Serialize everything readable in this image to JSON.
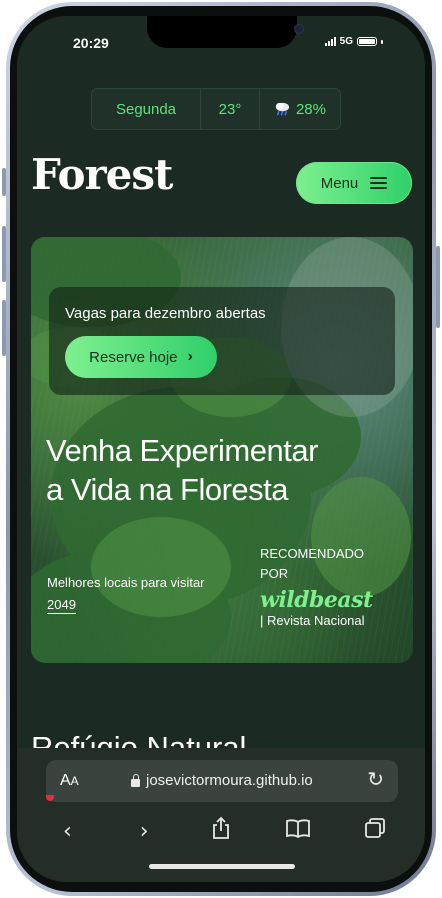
{
  "status_bar": {
    "time": "20:29",
    "network": "5G"
  },
  "info_bar": {
    "day": "Segunda",
    "temperature": "23°",
    "rain_chance": "28%",
    "rain_icon": "cloud-rain-icon"
  },
  "brand": "Forest",
  "menu": {
    "label": "Menu",
    "icon": "hamburger-icon"
  },
  "hero": {
    "notice": "Vagas para dezembro abertas",
    "cta_label": "Reserve hoje",
    "title_line1": "Venha Experimentar",
    "title_line2": "a Vida na Floresta",
    "places_label": "Melhores locais para visitar",
    "places_link": "2049",
    "recommended_line1": "RECOMENDADO",
    "recommended_line2": "POR",
    "publisher": "wildbeast",
    "publisher_sub": "| Revista Nacional"
  },
  "section": {
    "title": "Refúgio Natural"
  },
  "browser": {
    "text_size_label_big": "A",
    "text_size_label_small": "A",
    "url": "josevictormoura.github.io",
    "toolbar_icons": [
      "back-icon",
      "forward-icon",
      "share-icon",
      "bookmarks-icon",
      "tabs-icon"
    ]
  }
}
